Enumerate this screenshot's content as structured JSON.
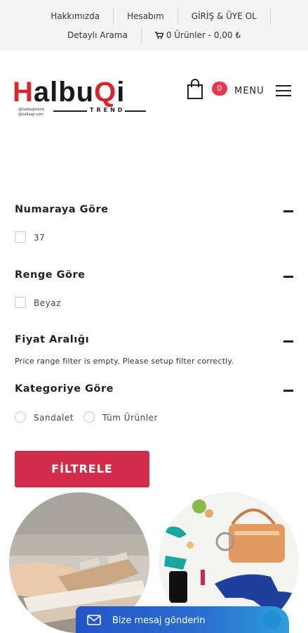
{
  "topbar": {
    "links_row1": [
      "Hakkımızda",
      "Hesabım",
      "GİRİŞ & ÜYE OL"
    ],
    "detailed_search": "Detaylı Arama",
    "cart_summary": "0 Ürünler - 0,00 ₺",
    "cart_icon": "cart-icon"
  },
  "header": {
    "logo": {
      "text_red_1": "H",
      "text_dark_1": "albu",
      "text_red_2": "Q",
      "text_dark_2": "i",
      "subtitle": "TREND",
      "small_line_1": "@halbuqitrend",
      "small_line_2": "@halbuqi.com"
    },
    "bag_icon": "shopping-bag-icon",
    "cart_count": "0",
    "menu_label": "MENU",
    "menu_icon": "hamburger-icon"
  },
  "filters": {
    "size": {
      "title": "Numaraya Göre",
      "options": [
        "37"
      ]
    },
    "color": {
      "title": "Renge Göre",
      "options": [
        "Beyaz"
      ]
    },
    "price": {
      "title": "Fiyat Aralığı",
      "note": "Price range filter is empty. Please setup filter correctly."
    },
    "category": {
      "title": "Kategoriye Göre",
      "options": [
        "Sandalet",
        "Tüm Ürünler"
      ]
    },
    "submit_label": "FİLTRELE"
  },
  "message_bar": {
    "label": "Bize mesaj gönderin",
    "icon": "envelope-icon"
  },
  "colors": {
    "accent": "#d22c4b",
    "badge": "#e8364f",
    "logo_red": "#d7262d",
    "message_bar": "#2a6fd0"
  }
}
